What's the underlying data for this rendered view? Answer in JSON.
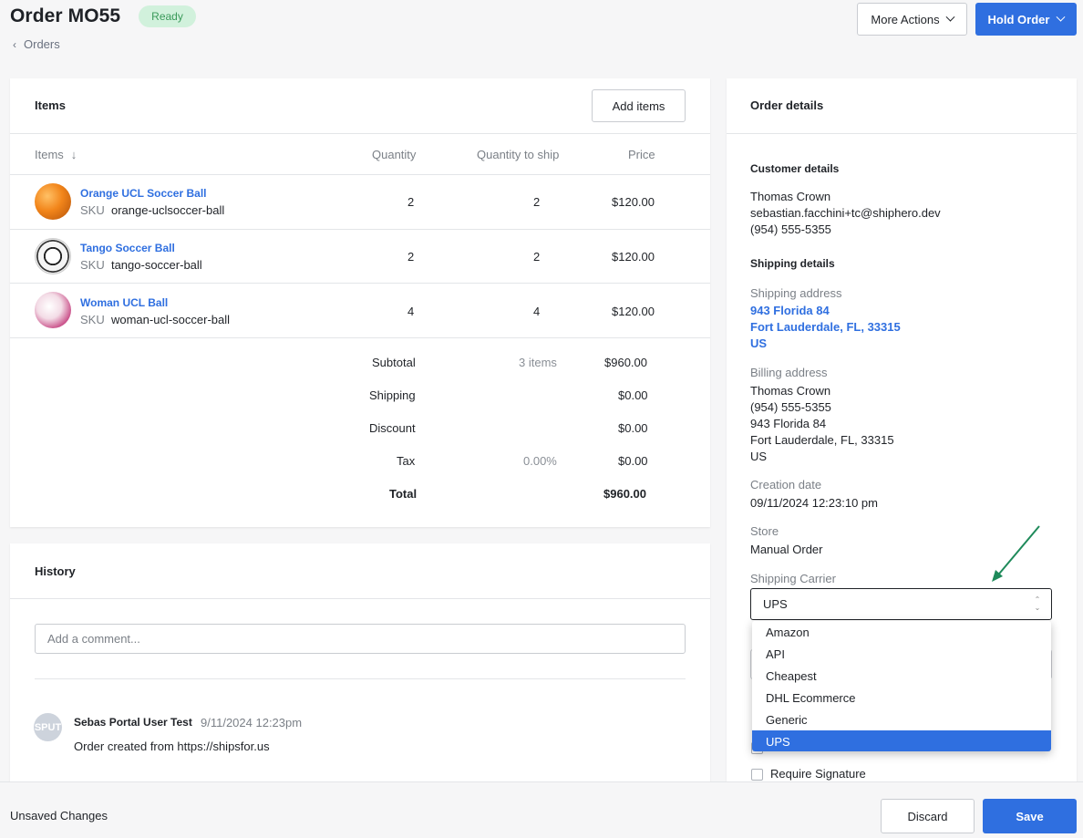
{
  "header": {
    "title": "Order MO55",
    "status": "Ready",
    "back_label": "Orders",
    "more_actions_label": "More Actions",
    "hold_order_label": "Hold Order"
  },
  "items_card": {
    "title": "Items",
    "add_items_label": "Add items",
    "columns": [
      "Items",
      "Quantity",
      "Quantity to ship",
      "Price"
    ],
    "rows": [
      {
        "name": "Orange UCL Soccer Ball",
        "sku_label": "SKU",
        "sku": "orange-uclsoccer-ball",
        "quantity": "2",
        "quantity_to_ship": "2",
        "price": "$120.00"
      },
      {
        "name": "Tango Soccer Ball",
        "sku_label": "SKU",
        "sku": "tango-soccer-ball",
        "quantity": "2",
        "quantity_to_ship": "2",
        "price": "$120.00"
      },
      {
        "name": "Woman UCL Ball",
        "sku_label": "SKU",
        "sku": "woman-ucl-soccer-ball",
        "quantity": "4",
        "quantity_to_ship": "4",
        "price": "$120.00"
      }
    ],
    "summary": {
      "subtotal_label": "Subtotal",
      "subtotal_count": "3 items",
      "subtotal_value": "$960.00",
      "shipping_label": "Shipping",
      "shipping_value": "$0.00",
      "discount_label": "Discount",
      "discount_value": "$0.00",
      "tax_label": "Tax",
      "tax_rate": "0.00%",
      "tax_value": "$0.00",
      "total_label": "Total",
      "total_value": "$960.00"
    }
  },
  "history": {
    "title": "History",
    "comment_placeholder": "Add a comment...",
    "entries": [
      {
        "avatar": "SPUT",
        "user": "Sebas Portal User Test",
        "time": "9/11/2024 12:23pm",
        "message": "Order created from https://shipsfor.us"
      }
    ]
  },
  "details": {
    "title": "Order details",
    "customer_heading": "Customer details",
    "customer_name": "Thomas Crown",
    "customer_email": "sebastian.facchini+tc@shiphero.dev",
    "customer_phone": "(954) 555-5355",
    "shipping_heading": "Shipping details",
    "shipping_address_label": "Shipping address",
    "shipping_address": [
      "943 Florida 84",
      "Fort Lauderdale, FL, 33315",
      "US"
    ],
    "billing_address_label": "Billing address",
    "billing_address": [
      "Thomas Crown",
      "(954) 555-5355",
      "943 Florida 84",
      "Fort Lauderdale, FL, 33315",
      "US"
    ],
    "creation_date_label": "Creation date",
    "creation_date": "09/11/2024 12:23:10 pm",
    "store_label": "Store",
    "store": "Manual Order",
    "carrier_label": "Shipping Carrier",
    "carrier_selected": "UPS",
    "carrier_options": [
      "Amazon",
      "API",
      "Cheapest",
      "DHL Ecommerce",
      "Generic",
      "UPS"
    ],
    "require_signature_label": "Require Signature"
  },
  "footer": {
    "unsaved_label": "Unsaved Changes",
    "discard_label": "Discard",
    "save_label": "Save"
  },
  "colors": {
    "accent": "#2f6fe0",
    "ready_badge_bg": "#d1f1dc",
    "ready_badge_text": "#3a9a5a",
    "annotation_arrow": "#1e8a5a"
  }
}
